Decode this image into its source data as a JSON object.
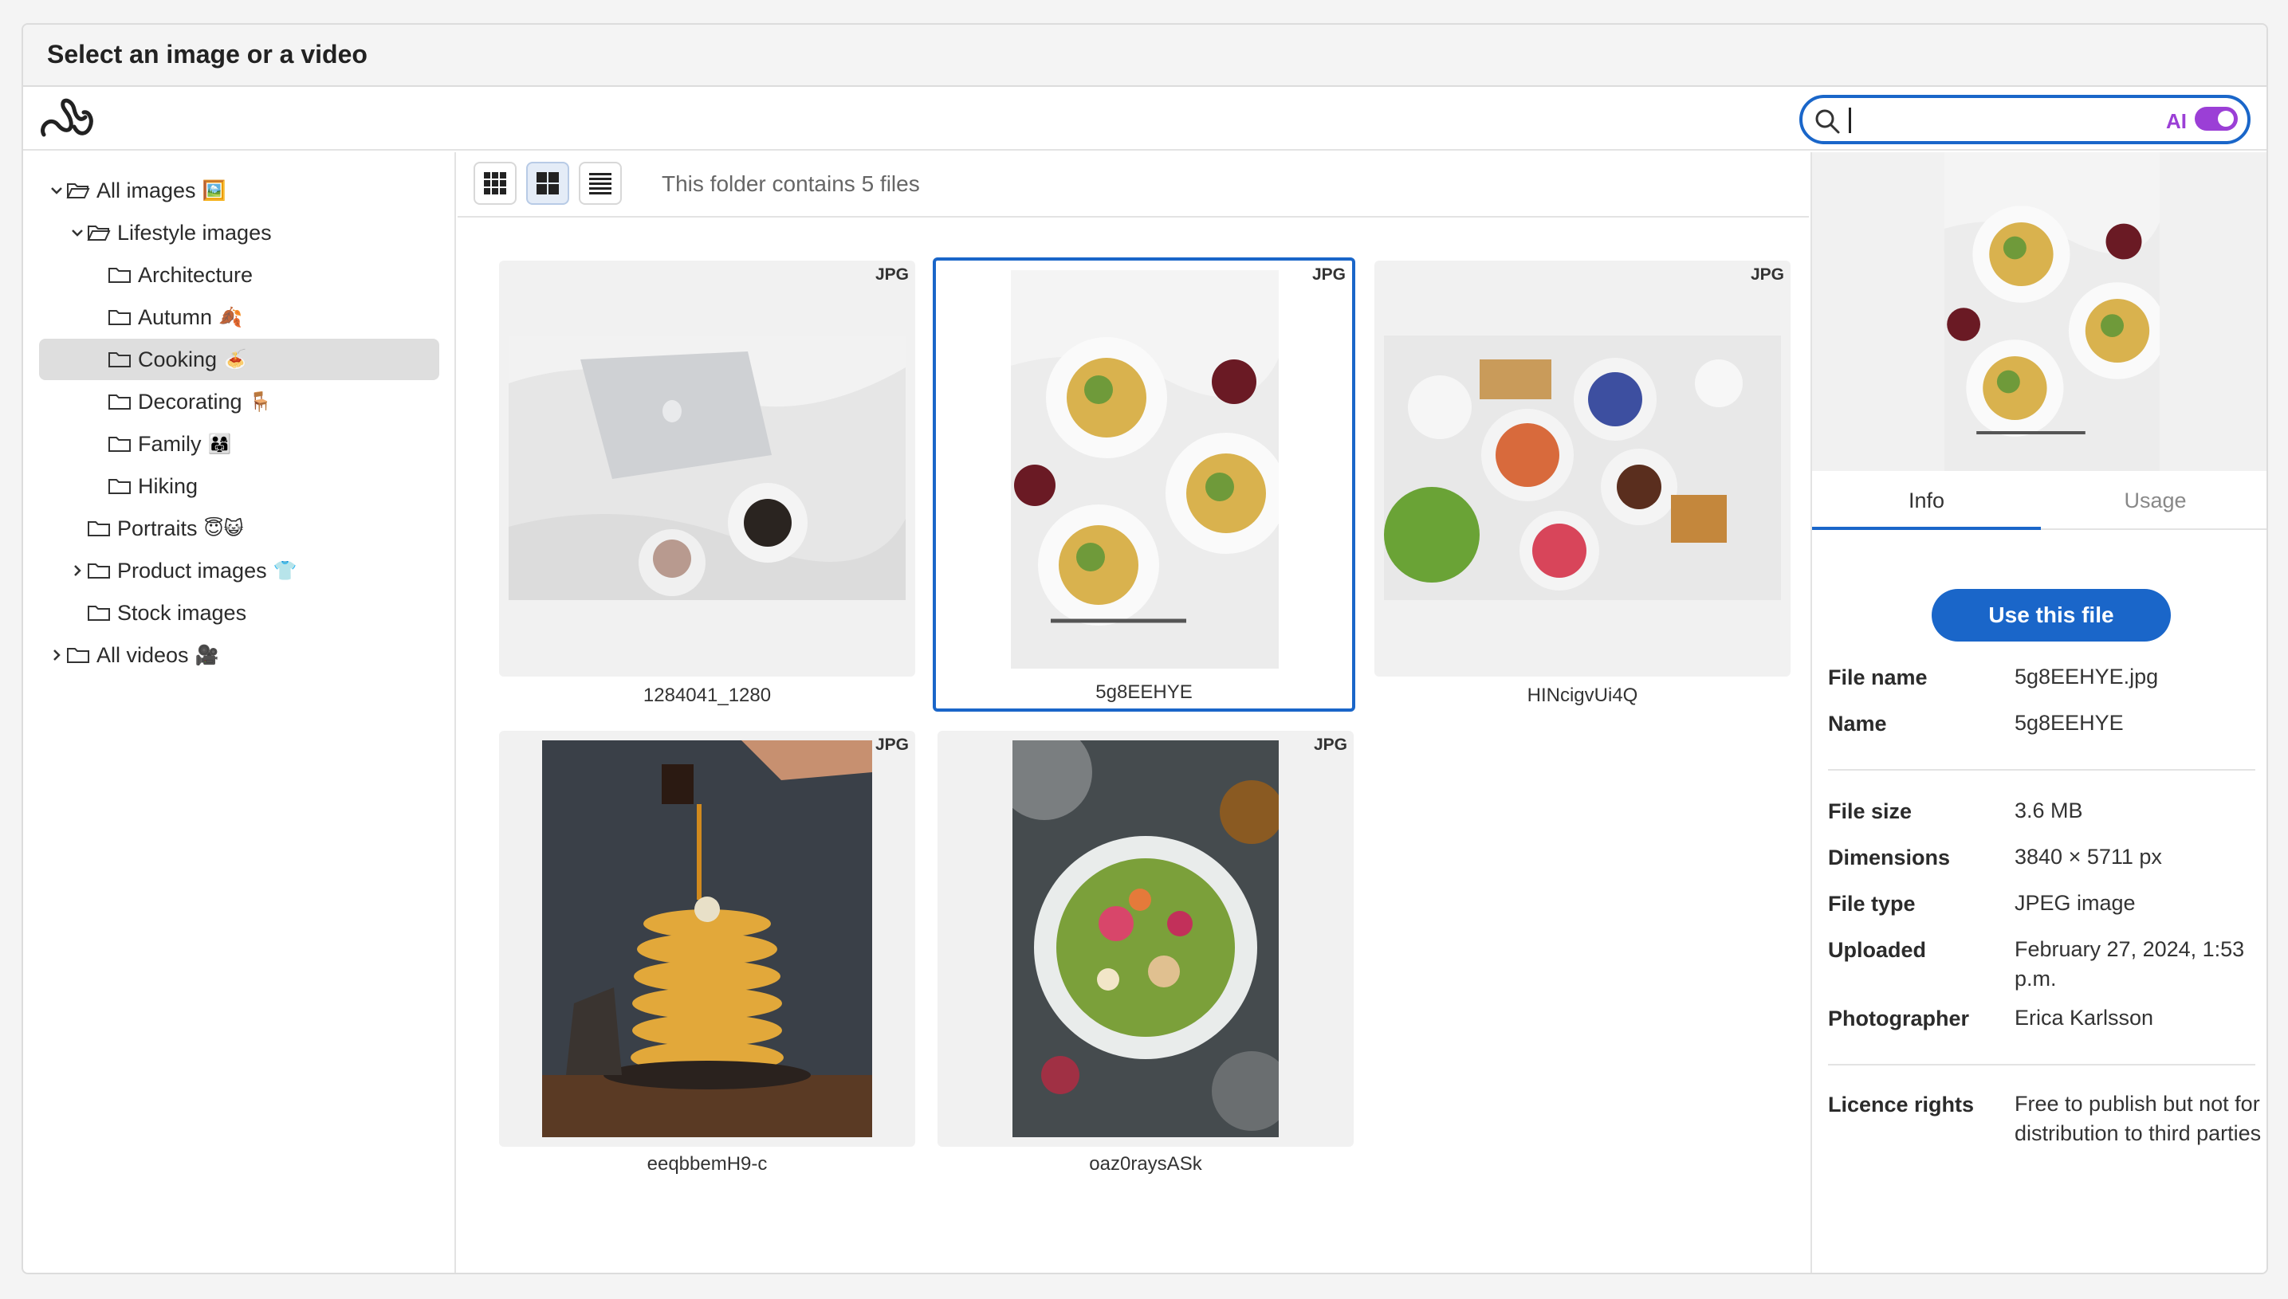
{
  "dialog": {
    "title": "Select an image or a video"
  },
  "search": {
    "value": "",
    "ai_label": "AI",
    "ai_enabled": true
  },
  "sidebar": {
    "items": [
      {
        "label": "All images",
        "emoji": "🖼️",
        "level": 0,
        "expanded": true,
        "chevron": "down"
      },
      {
        "label": "Lifestyle images",
        "emoji": "",
        "level": 1,
        "expanded": true,
        "chevron": "down"
      },
      {
        "label": "Architecture",
        "emoji": "",
        "level": 2
      },
      {
        "label": "Autumn",
        "emoji": "🍂",
        "level": 2
      },
      {
        "label": "Cooking",
        "emoji": "🍝",
        "level": 2,
        "selected": true
      },
      {
        "label": "Decorating",
        "emoji": "🪑",
        "level": 2
      },
      {
        "label": "Family",
        "emoji": "👨‍👩‍👧",
        "level": 2
      },
      {
        "label": "Hiking",
        "emoji": "",
        "level": 2
      },
      {
        "label": "Portraits",
        "emoji": "😇😺",
        "level": 1
      },
      {
        "label": "Product images",
        "emoji": "👕",
        "level": 1,
        "chevron": "right"
      },
      {
        "label": "Stock images",
        "emoji": "",
        "level": 1
      },
      {
        "label": "All videos",
        "emoji": "🎥",
        "level": 0,
        "chevron": "right"
      }
    ]
  },
  "toolbar": {
    "folder_info": "This folder contains 5 files",
    "active_view": "medium-grid"
  },
  "files": [
    {
      "name": "1284041_1280",
      "badge": "JPG"
    },
    {
      "name": "5g8EEHYE",
      "badge": "JPG",
      "selected": true
    },
    {
      "name": "HINcigvUi4Q",
      "badge": "JPG"
    },
    {
      "name": "eeqbbemH9-c",
      "badge": "JPG"
    },
    {
      "name": "oaz0raysASk",
      "badge": "JPG"
    }
  ],
  "details": {
    "tabs": [
      {
        "label": "Info",
        "active": true
      },
      {
        "label": "Usage"
      }
    ],
    "use_button": "Use this file",
    "fields": [
      {
        "label": "File name",
        "value": "5g8EEHYE.jpg"
      },
      {
        "label": "Name",
        "value": "5g8EEHYE"
      },
      {
        "label": "File size",
        "value": "3.6 MB"
      },
      {
        "label": "Dimensions",
        "value": "3840 × 5711 px"
      },
      {
        "label": "File type",
        "value": "JPEG image"
      },
      {
        "label": "Uploaded",
        "value": "February 27, 2024, 1:53 p.m."
      },
      {
        "label": "Photographer",
        "value": "Erica Karlsson"
      },
      {
        "label": "Licence rights",
        "value": "Free to publish but not for distribution to third parties"
      }
    ]
  },
  "colors": {
    "accent": "#1a66c9",
    "ai": "#9b3fd6",
    "selected_row": "#dedede"
  }
}
